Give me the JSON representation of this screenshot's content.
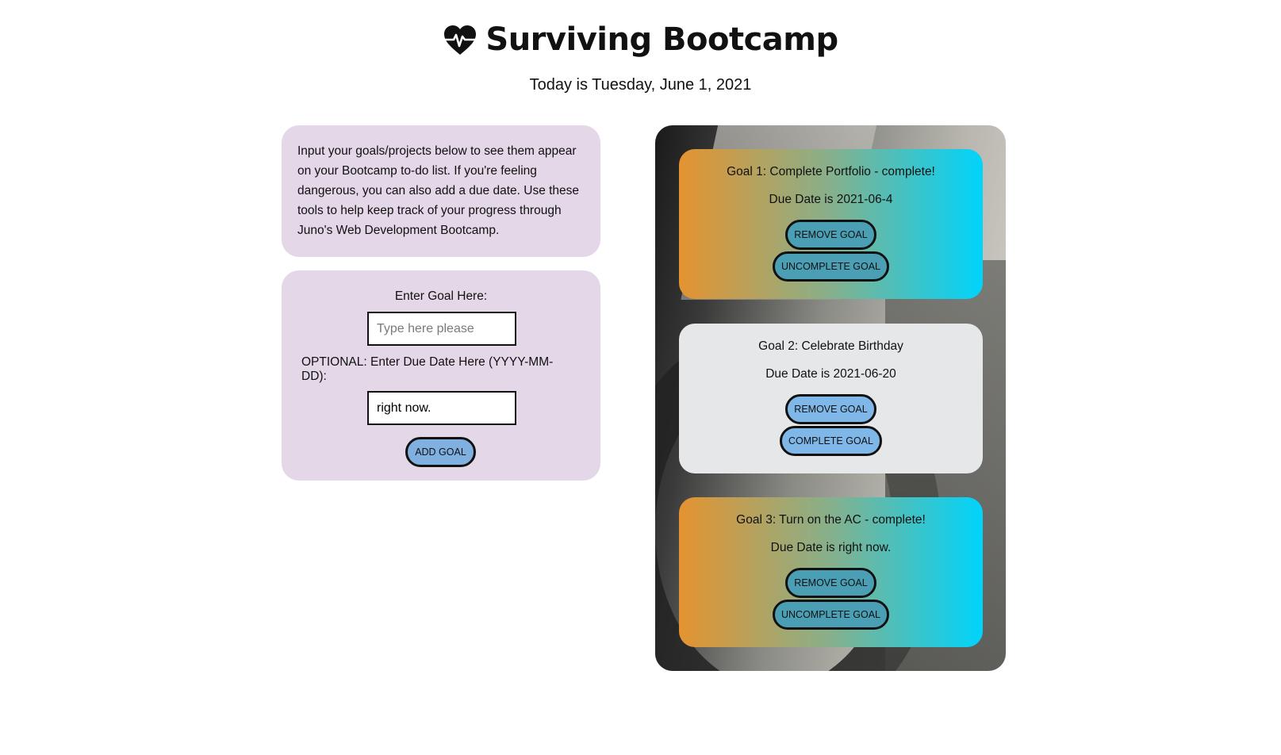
{
  "header": {
    "title": "Surviving Bootcamp",
    "date_text": "Today is Tuesday, June 1, 2021"
  },
  "intro": {
    "text": "Input your goals/projects below to see them appear on your Bootcamp to-do list. If you're feeling dangerous, you can also add a due date. Use these tools to help keep track of your progress through Juno's Web Development Bootcamp."
  },
  "form": {
    "goal_label": "Enter Goal Here:",
    "goal_placeholder": "Type here please",
    "goal_value": "",
    "due_label": "OPTIONAL: Enter Due Date Here (YYYY-MM-DD):",
    "due_value": "right now.",
    "add_label": "ADD GOAL"
  },
  "goals": [
    {
      "title": "Goal 1: Complete Portfolio - complete!",
      "due": "Due Date is 2021-06-4",
      "remove_label": "REMOVE GOAL",
      "toggle_label": "UNCOMPLETE GOAL",
      "complete": true
    },
    {
      "title": "Goal 2: Celebrate Birthday",
      "due": "Due Date is 2021-06-20",
      "remove_label": "REMOVE GOAL",
      "toggle_label": "COMPLETE GOAL",
      "complete": false
    },
    {
      "title": "Goal 3: Turn on the AC - complete!",
      "due": "Due Date is right now.",
      "remove_label": "REMOVE GOAL",
      "toggle_label": "UNCOMPLETE GOAL",
      "complete": true
    }
  ],
  "colors": {
    "panel_bg": "#e4d7e8",
    "complete_gradient_start": "#e59330",
    "complete_gradient_end": "#00d4fb",
    "incomplete_card_bg": "#e6e7e8",
    "add_button_bg": "#7fb0e0"
  },
  "icons": {
    "title_icon": "heart-pulse-icon"
  }
}
